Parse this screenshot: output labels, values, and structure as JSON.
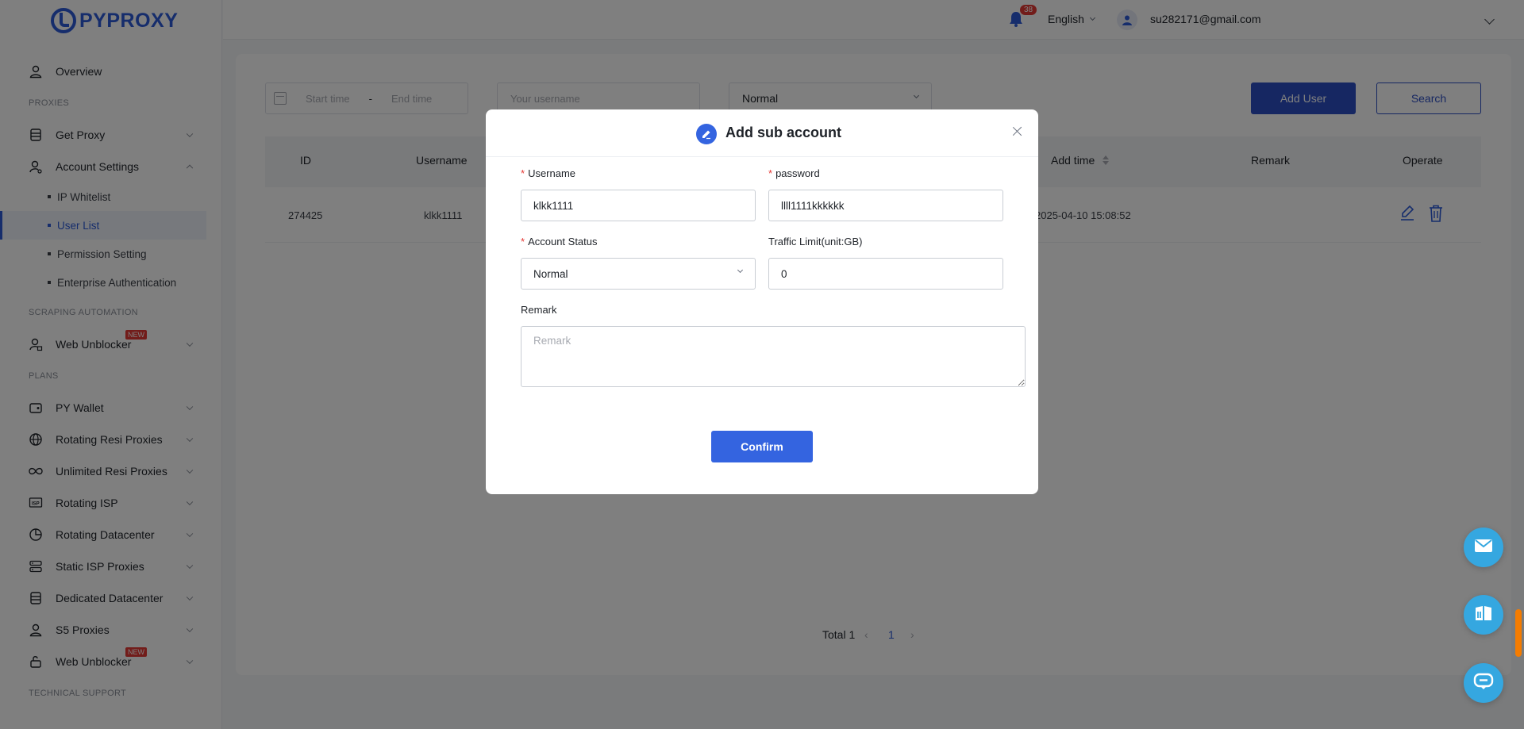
{
  "app": {
    "logo_text": "PYPROXY"
  },
  "header": {
    "notification_count": "38",
    "language": "English",
    "user_email": "su282171@gmail.com"
  },
  "sidebar": {
    "overview": "Overview",
    "section_proxies": "PROXIES",
    "get_proxy": "Get Proxy",
    "account_settings": "Account Settings",
    "sub_items": [
      "IP Whitelist",
      "User List",
      "Permission Setting",
      "Enterprise Authentication"
    ],
    "section_scraping": "SCRAPING AUTOMATION",
    "web_unblocker": "Web Unblocker",
    "new_badge": "NEW",
    "section_plans": "PLANS",
    "py_wallet": "PY Wallet",
    "rotating_resi": "Rotating Resi Proxies",
    "unlimited_resi": "Unlimited Resi Proxies",
    "rotating_isp": "Rotating ISP",
    "rotating_datacenter": "Rotating Datacenter",
    "static_isp": "Static ISP Proxies",
    "dedicated_datacenter": "Dedicated Datacenter",
    "s5_proxies": "S5 Proxies",
    "web_unblocker_2": "Web Unblocker",
    "section_support": "TECHNICAL SUPPORT"
  },
  "filters": {
    "start_time": "Start time",
    "separator": "-",
    "end_time": "End time",
    "username_placeholder": "Your username",
    "status_value": "Normal",
    "add_user": "Add User",
    "search": "Search"
  },
  "table": {
    "headers": {
      "id": "ID",
      "username": "Username",
      "add_time": "Add time",
      "remark": "Remark",
      "operate": "Operate"
    },
    "rows": [
      {
        "id": "274425",
        "username": "klkk1111",
        "add_time": "2025-04-10 15:08:52"
      }
    ]
  },
  "pagination": {
    "total": "Total 1",
    "current_page": "1"
  },
  "modal": {
    "title": "Add sub account",
    "username_label": "Username",
    "username_value": "klkk1111",
    "password_label": "password",
    "password_value": "llll1111kkkkkk",
    "status_label": "Account Status",
    "status_value": "Normal",
    "traffic_label": "Traffic Limit(unit:GB)",
    "traffic_value": "0",
    "remark_label": "Remark",
    "remark_placeholder": "Remark",
    "confirm": "Confirm"
  },
  "colors": {
    "primary": "#3464e0",
    "brand": "#2d5bd8",
    "badge_red": "#e53935",
    "fab": "#35a7e0"
  }
}
